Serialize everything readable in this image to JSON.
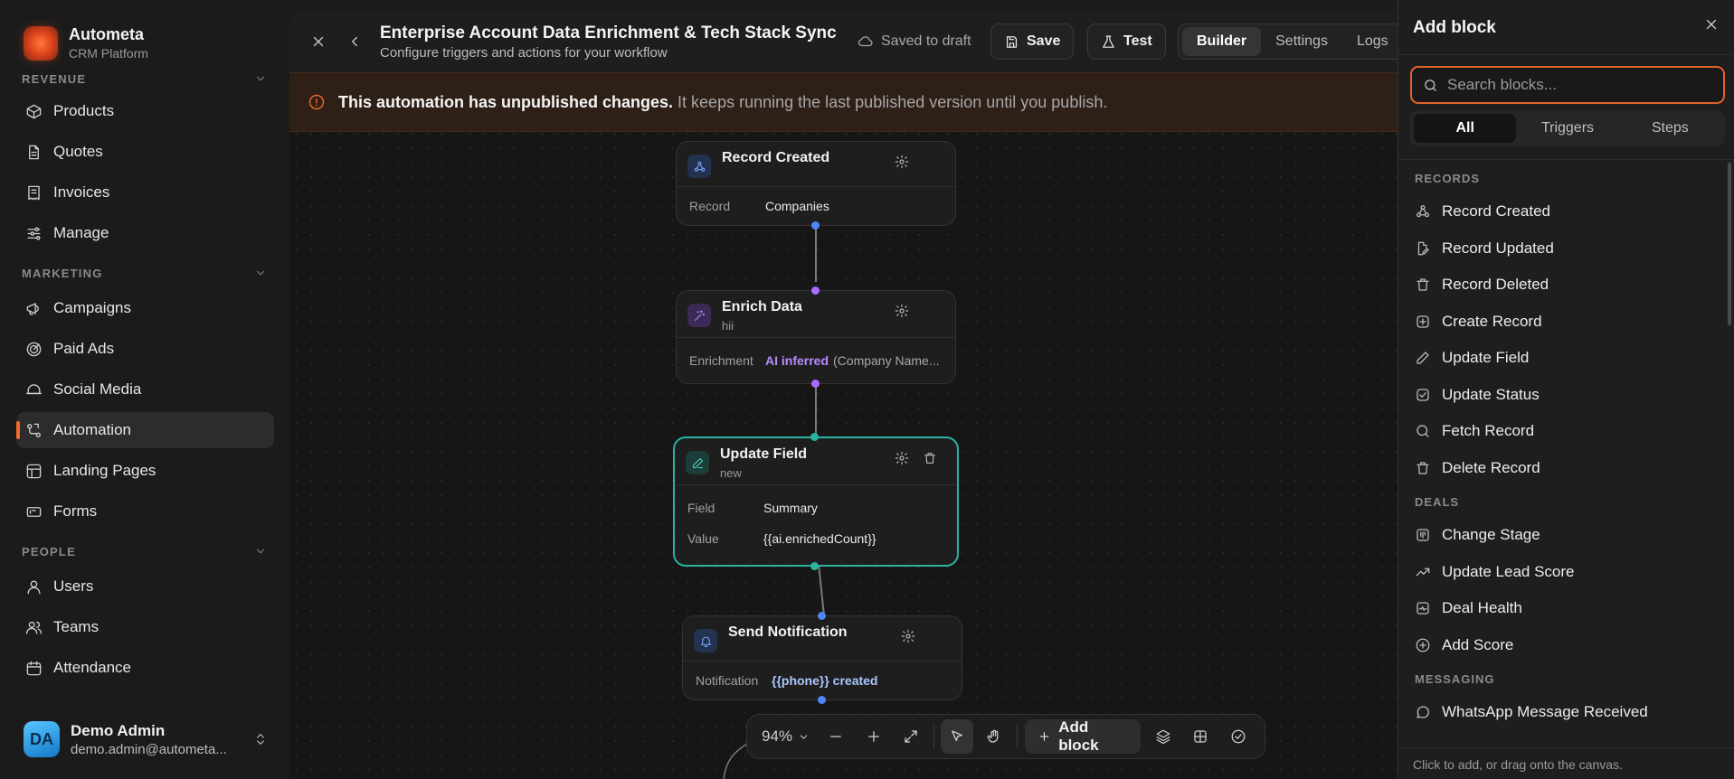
{
  "brand": {
    "name": "Autometa",
    "sub": "CRM Platform"
  },
  "sidebar": {
    "revenue_label": "REVENUE",
    "revenue_items": [
      "Products",
      "Quotes",
      "Invoices",
      "Manage"
    ],
    "marketing_label": "MARKETING",
    "marketing_items": [
      "Campaigns",
      "Paid Ads",
      "Social Media",
      "Automation",
      "Landing Pages",
      "Forms"
    ],
    "people_label": "PEOPLE",
    "people_items": [
      "Users",
      "Teams",
      "Attendance"
    ],
    "active_item": "Automation"
  },
  "user": {
    "name": "Demo Admin",
    "email": "demo.admin@autometa...",
    "initials": "DA"
  },
  "topbar": {
    "title": "Enterprise Account Data Enrichment & Tech Stack Sync",
    "subtitle": "Configure triggers and actions for your workflow",
    "saved_status": "Saved to draft",
    "save_label": "Save",
    "test_label": "Test",
    "tabs": [
      "Builder",
      "Settings",
      "Logs"
    ],
    "active_tab": "Builder"
  },
  "banner": {
    "bold": "This automation has unpublished changes.",
    "rest": "It keeps running the last published version until you publish."
  },
  "nodes": {
    "n1": {
      "title": "Record Created",
      "row_label": "Record",
      "row_value": "Companies"
    },
    "n2": {
      "title": "Enrich Data",
      "sub": "hii",
      "row_label": "Enrichment",
      "row_highlight": "AI inferred",
      "row_value": "(Company Name..."
    },
    "n3": {
      "title": "Update Field",
      "sub": "new",
      "row1_label": "Field",
      "row1_value": "Summary",
      "row2_label": "Value",
      "row2_value": "{{ai.enrichedCount}}"
    },
    "n4": {
      "title": "Send Notification",
      "row_label": "Notification",
      "row_value": "{{phone}} created"
    }
  },
  "toolbar": {
    "zoom": "94%",
    "add_block": "Add block"
  },
  "panel": {
    "title": "Add block",
    "search_placeholder": "Search blocks...",
    "tabs": [
      "All",
      "Triggers",
      "Steps"
    ],
    "active_tab": "All",
    "sections": [
      {
        "label": "RECORDS",
        "items": [
          {
            "label": "Record Created",
            "icon": "webhook-icon"
          },
          {
            "label": "Record Updated",
            "icon": "file-edit-icon"
          },
          {
            "label": "Record Deleted",
            "icon": "trash-icon"
          },
          {
            "label": "Create Record",
            "icon": "plus-square-icon"
          },
          {
            "label": "Update Field",
            "icon": "pencil-icon"
          },
          {
            "label": "Update Status",
            "icon": "check-square-icon"
          },
          {
            "label": "Fetch Record",
            "icon": "search-icon"
          },
          {
            "label": "Delete Record",
            "icon": "trash-icon"
          }
        ]
      },
      {
        "label": "DEALS",
        "items": [
          {
            "label": "Change Stage",
            "icon": "kanban-icon"
          },
          {
            "label": "Update Lead Score",
            "icon": "trending-up-icon"
          },
          {
            "label": "Deal Health",
            "icon": "activity-icon"
          },
          {
            "label": "Add Score",
            "icon": "plus-circle-icon"
          }
        ]
      },
      {
        "label": "MESSAGING",
        "items": [
          {
            "label": "WhatsApp Message Received",
            "icon": "message-circle-icon"
          }
        ]
      }
    ],
    "footer": "Click to add, or drag onto the canvas."
  },
  "colors": {
    "accent": "#f26a2e",
    "selected_node": "#2ab3a0",
    "ai_purple": "#a66bff",
    "port_blue": "#4f86f7",
    "port_purple": "#a66bff",
    "port_teal": "#2ab3a0"
  }
}
